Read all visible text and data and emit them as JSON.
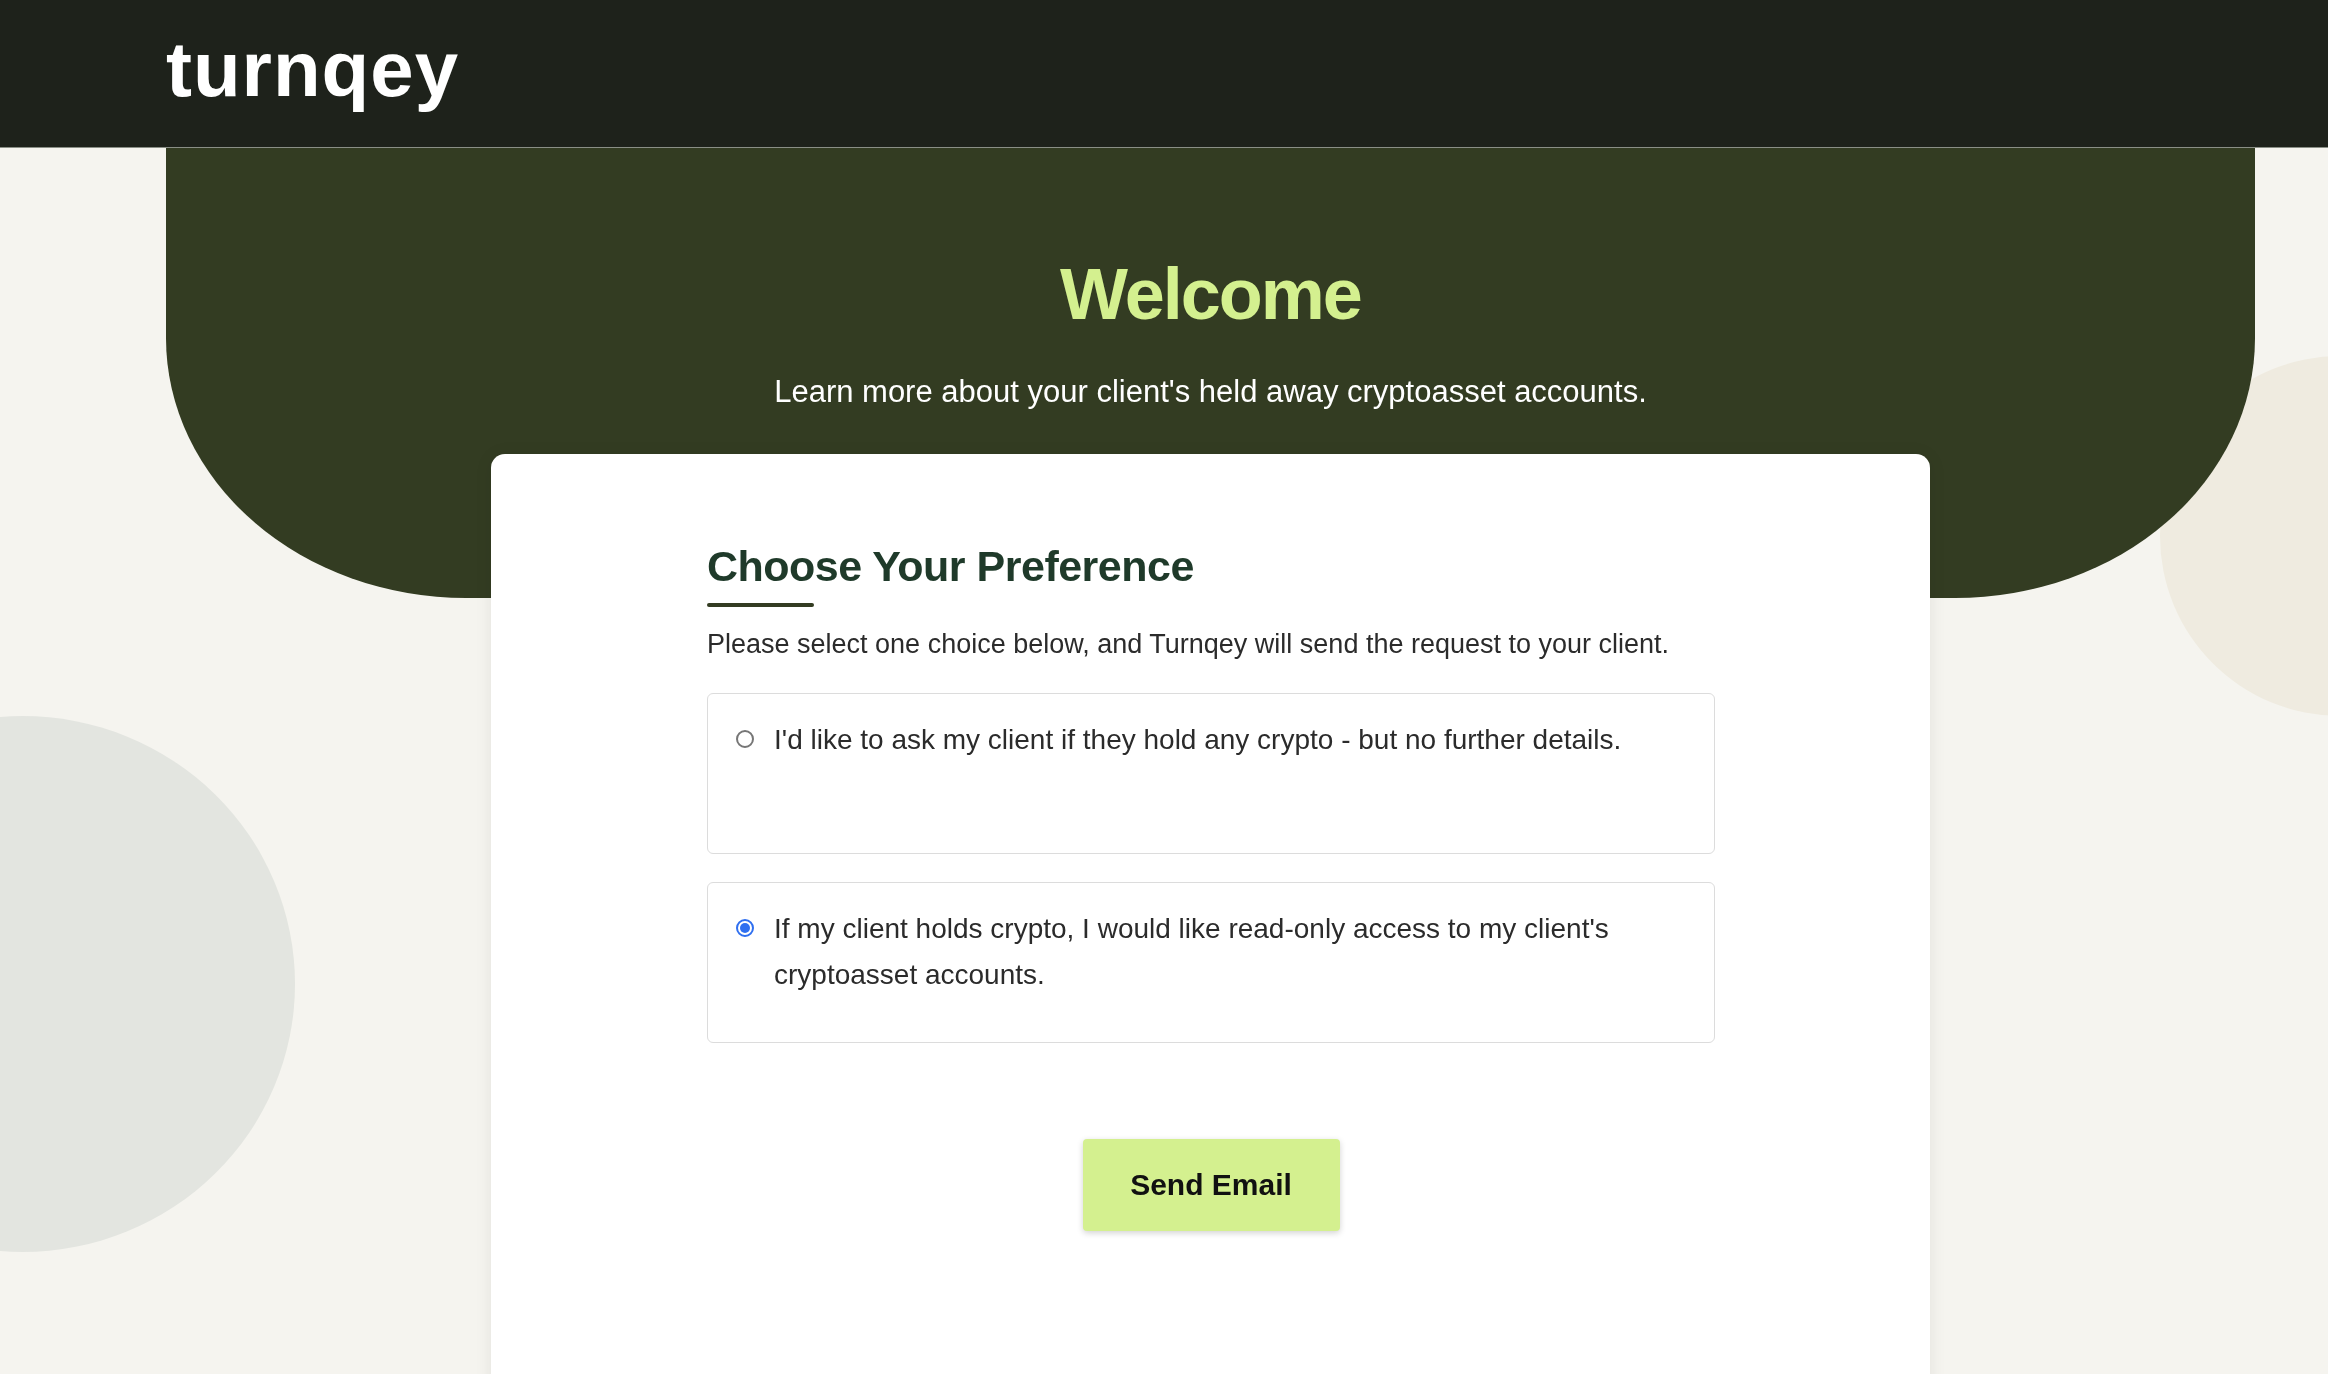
{
  "header": {
    "logo": "turnqey"
  },
  "banner": {
    "title": "Welcome",
    "subtitle": "Learn more about your client's held away cryptoasset accounts."
  },
  "card": {
    "heading": "Choose Your Preference",
    "instructions": "Please select one choice below, and Turnqey will send the request to your client.",
    "options": [
      {
        "label": "I'd like to ask my client if they hold any crypto - but no further details.",
        "selected": false
      },
      {
        "label": "If my client holds crypto, I would like read-only access to my client's cryptoasset accounts.",
        "selected": true
      }
    ],
    "button": "Send Email"
  }
}
